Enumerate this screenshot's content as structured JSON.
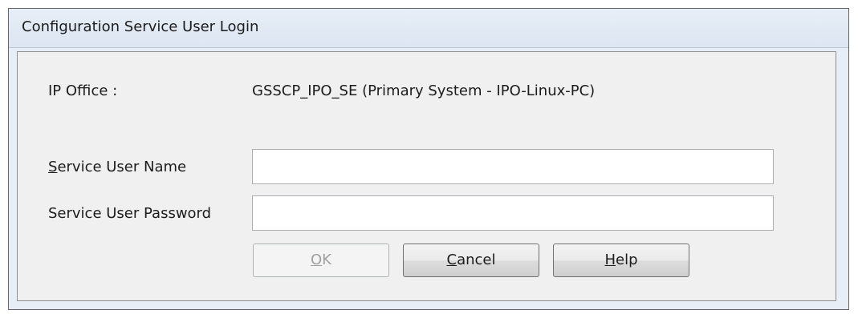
{
  "window": {
    "title": "Configuration Service User Login"
  },
  "ip_office": {
    "label": "IP Office :",
    "value": "GSSCP_IPO_SE (Primary System - IPO-Linux-PC)"
  },
  "form": {
    "username": {
      "label_first": "S",
      "label_rest": "ervice User Name",
      "value": "",
      "placeholder": ""
    },
    "password": {
      "label": "Service User Password",
      "value": "",
      "placeholder": ""
    }
  },
  "buttons": {
    "ok": {
      "mnemonic": "O",
      "rest": "K",
      "enabled": false
    },
    "cancel": {
      "mnemonic": "C",
      "rest": "ancel",
      "enabled": true
    },
    "help": {
      "mnemonic": "H",
      "rest": "elp",
      "enabled": true
    }
  }
}
